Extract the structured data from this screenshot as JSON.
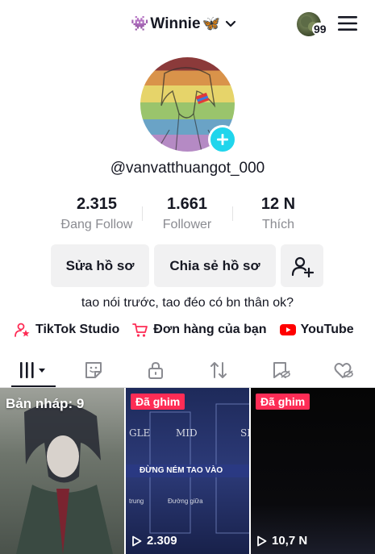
{
  "header": {
    "emoji_left": "👾",
    "username": "Winnie",
    "emoji_right": "🦋",
    "notification_count": "99"
  },
  "profile": {
    "handle": "@vanvatthuangot_000",
    "bio": "tao nói trước, tao đéo có bn thân ok?"
  },
  "stats": [
    {
      "value": "2.315",
      "label": "Đang Follow"
    },
    {
      "value": "1.661",
      "label": "Follower"
    },
    {
      "value": "12 N",
      "label": "Thích"
    }
  ],
  "buttons": {
    "edit_profile": "Sửa hồ sơ",
    "share_profile": "Chia sẻ hồ sơ"
  },
  "links": {
    "studio": "TikTok Studio",
    "orders": "Đơn hàng của bạn",
    "youtube": "YouTube"
  },
  "grid": {
    "draft_label": "Bản nháp: 9",
    "pinned_label": "Đã ghim",
    "tiles": [
      {
        "views": ""
      },
      {
        "views": "2.309",
        "overlay_main": "ĐỪNG NÉM TAO VÀO",
        "overlay_top_left": "GLE",
        "overlay_top_mid": "MID",
        "overlay_top_right": "SI",
        "overlay_sub_left": "trung",
        "overlay_sub_mid": "Đường giữa"
      },
      {
        "views": "10,7 N"
      }
    ]
  },
  "colors": {
    "accent_cyan": "#20d5ec",
    "pin_red": "#fe2c55",
    "youtube_red": "#ff0000",
    "muted_text": "#8a8b91"
  }
}
